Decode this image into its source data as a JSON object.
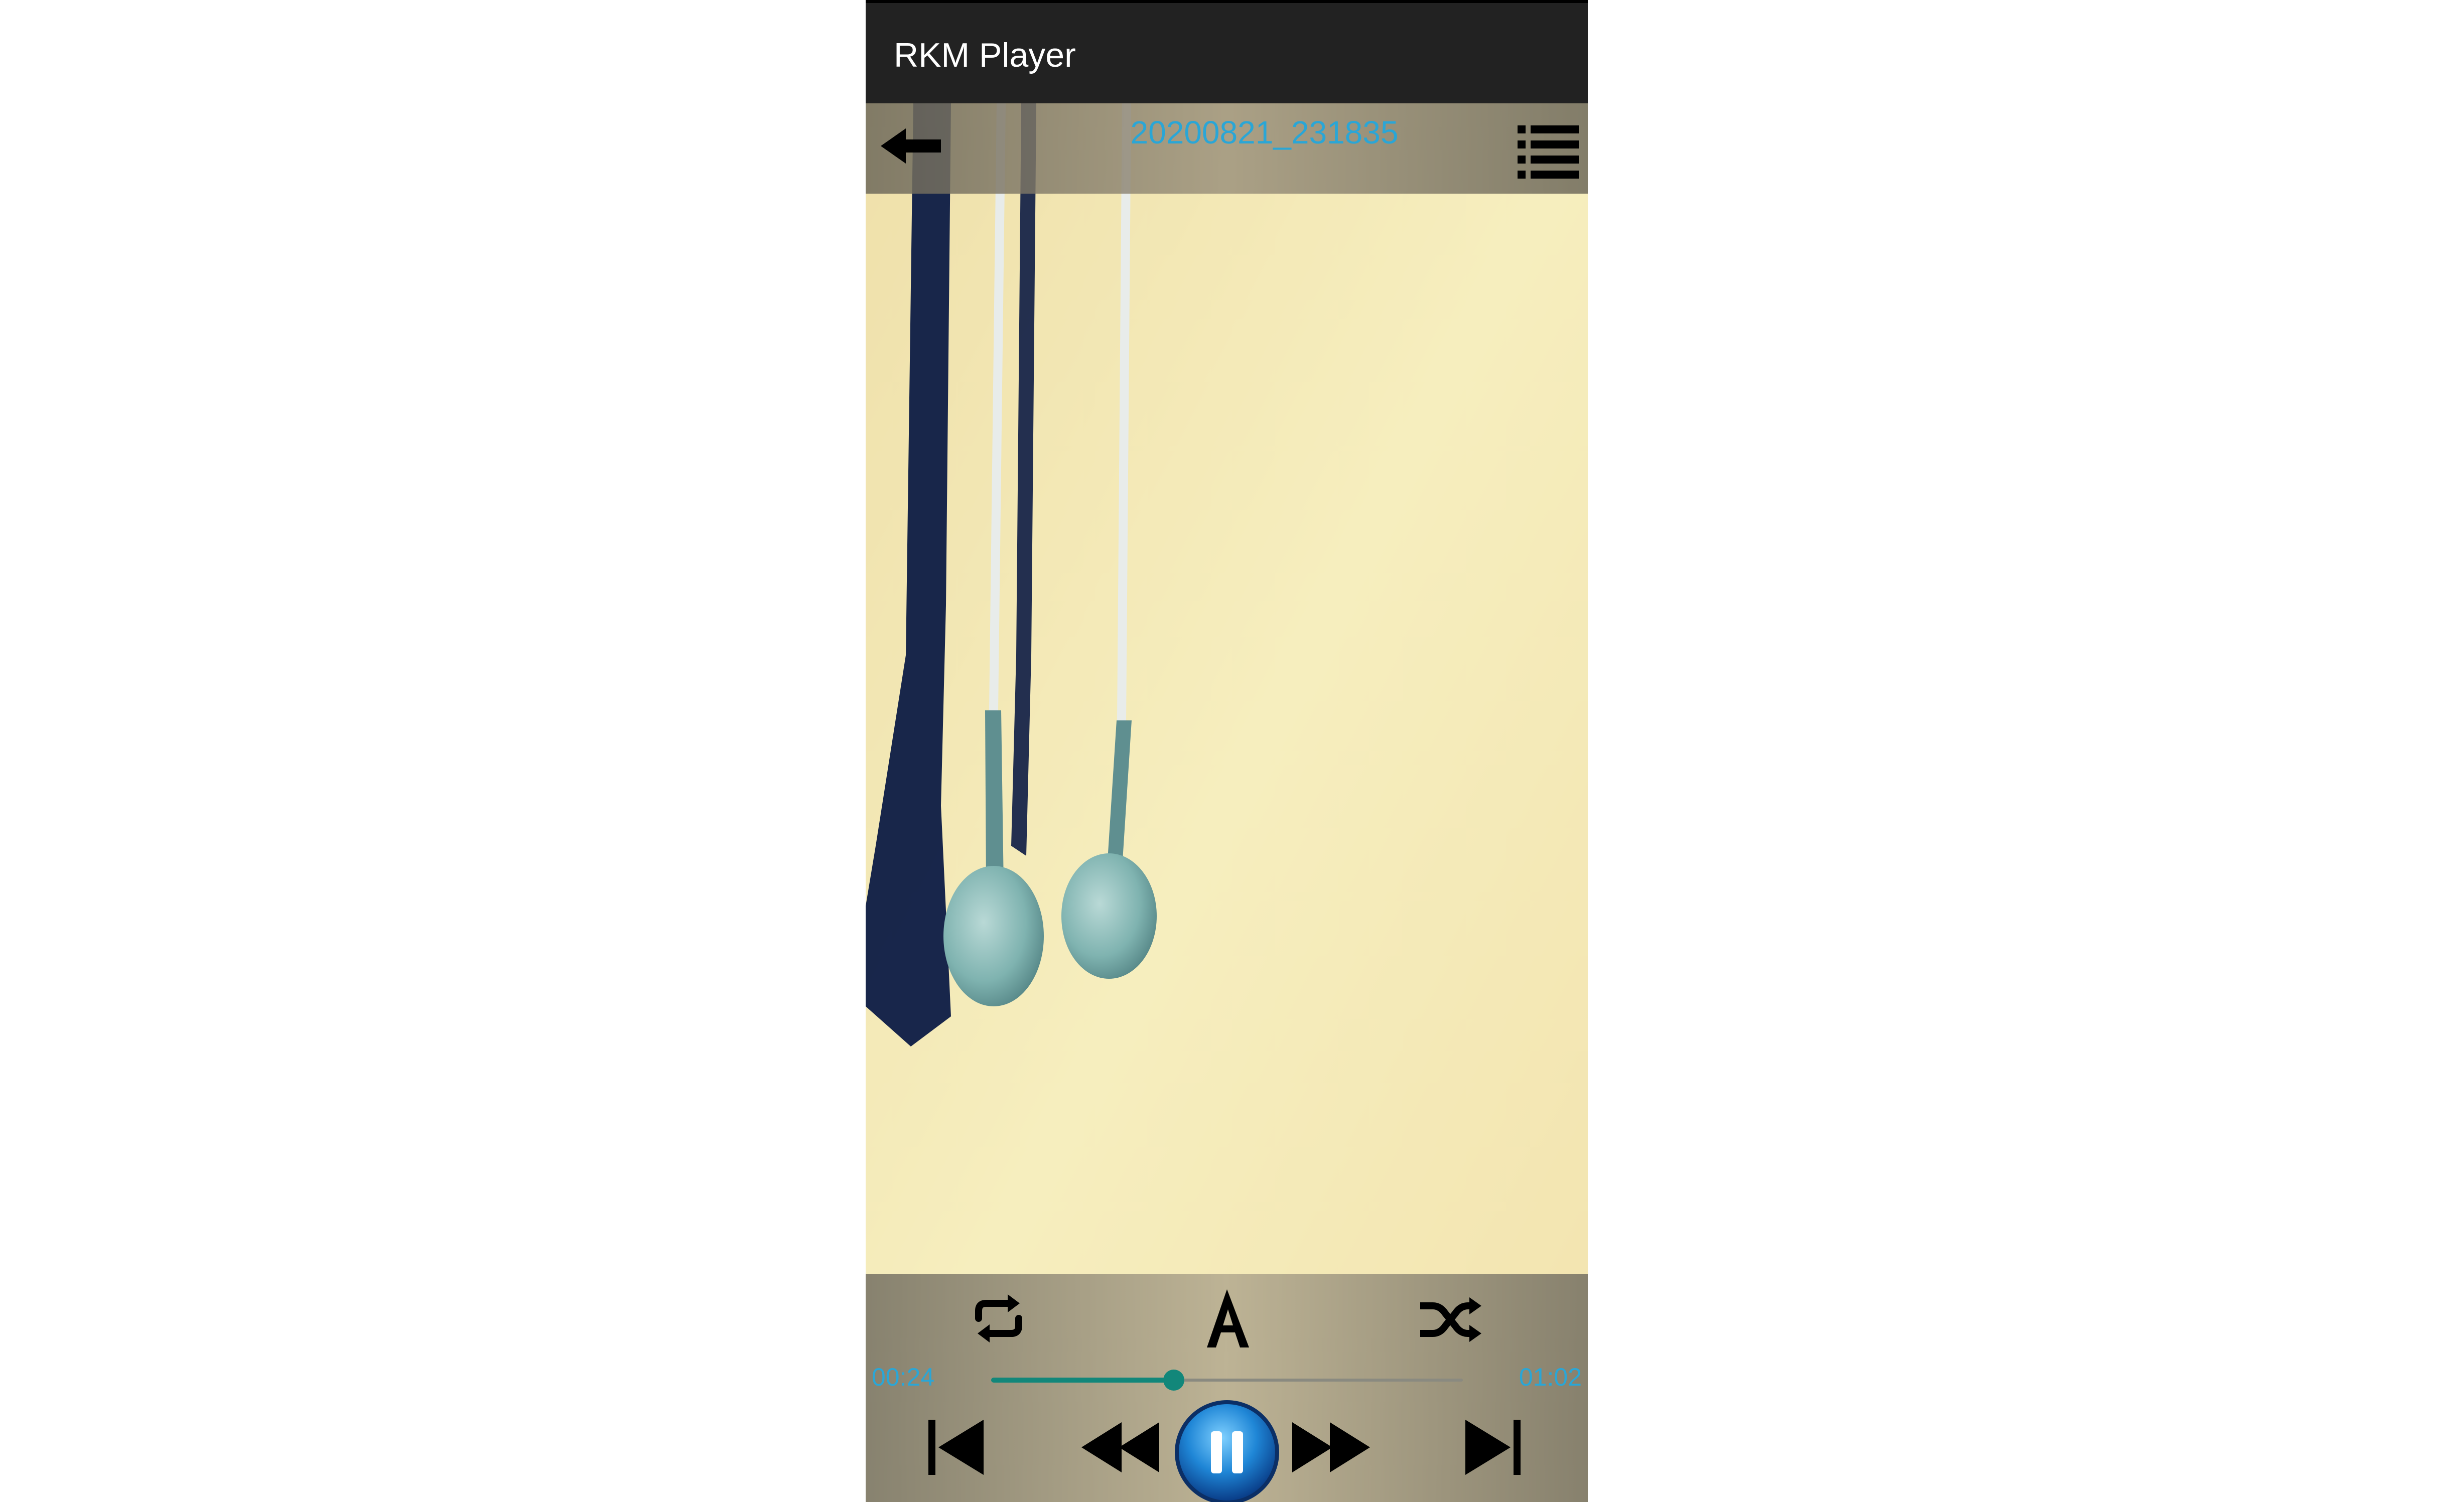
{
  "app": {
    "title": "RKM Player"
  },
  "player": {
    "track_title": "20200821_231835",
    "time_current": "00:24",
    "time_total": "01:02",
    "progress_fraction": 0.387,
    "state": "playing"
  },
  "icons": {
    "back": "back-arrow-icon",
    "playlist": "playlist-icon",
    "repeat": "repeat-icon",
    "font": "font-icon",
    "shuffle": "shuffle-icon",
    "previous": "skip-previous-icon",
    "rewind": "rewind-icon",
    "pause": "pause-icon",
    "fast_forward": "fast-forward-icon",
    "next": "skip-next-icon"
  },
  "colors": {
    "accent": "#2aa6d6",
    "seek": "#12877a",
    "app_bar": "#222222"
  }
}
